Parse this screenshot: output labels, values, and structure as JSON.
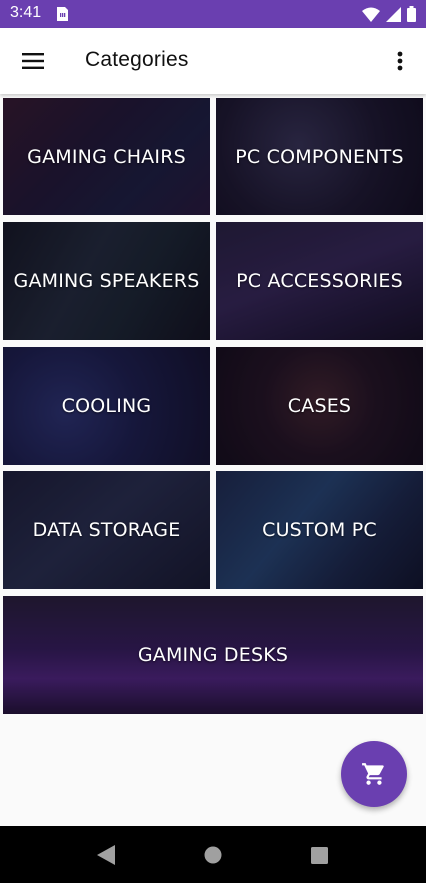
{
  "status_bar": {
    "time": "3:41",
    "icons": [
      "sim-card-icon",
      "wifi-icon",
      "signal-icon",
      "battery-icon"
    ]
  },
  "app_bar": {
    "title": "Categories",
    "menu_icon": "hamburger-menu-icon",
    "more_icon": "more-vert-icon"
  },
  "categories": [
    {
      "label": "GAMING CHAIRS"
    },
    {
      "label": "PC COMPONENTS"
    },
    {
      "label": "GAMING SPEAKERS"
    },
    {
      "label": "PC ACCESSORIES"
    },
    {
      "label": "COOLING"
    },
    {
      "label": "CASES"
    },
    {
      "label": "DATA STORAGE"
    },
    {
      "label": "CUSTOM PC"
    },
    {
      "label": "GAMING DESKS"
    }
  ],
  "fab": {
    "icon": "shopping-cart-icon"
  },
  "nav_bar": {
    "icons": [
      "back-icon",
      "home-icon",
      "recents-icon"
    ]
  },
  "colors": {
    "primary": "#6a3fb0",
    "tile_overlay": "#1a1030"
  }
}
